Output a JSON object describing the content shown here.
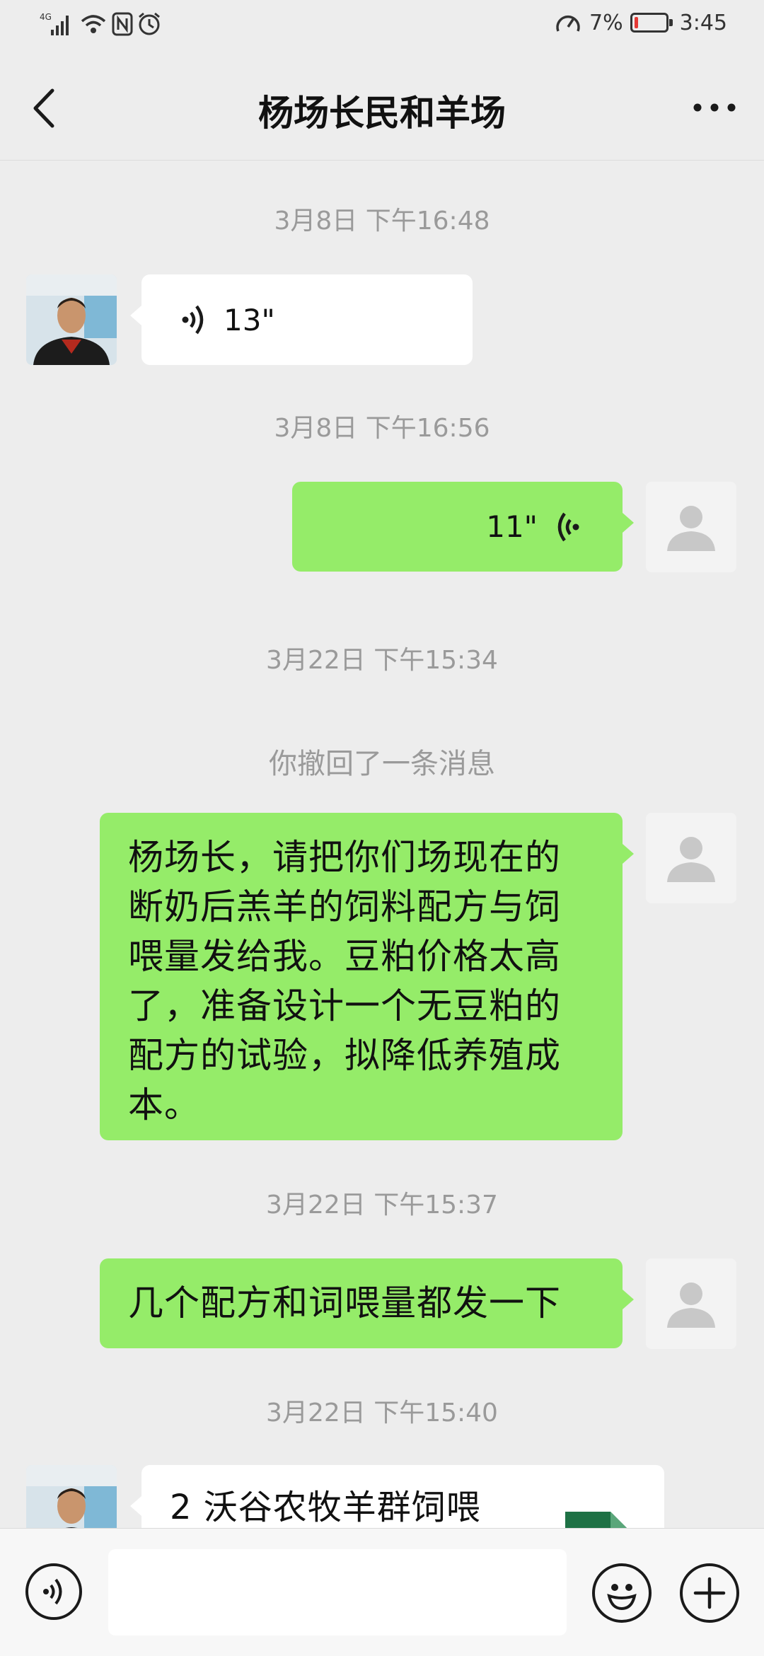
{
  "status_bar": {
    "network": "4G",
    "battery": "7%",
    "time": "3:45"
  },
  "header": {
    "title": "杨场长民和羊场",
    "back_icon": "chevron-left-icon",
    "more_icon": "more-dots-icon"
  },
  "messages": [
    {
      "type": "timestamp",
      "text": "3月8日 下午16:48"
    },
    {
      "type": "voice",
      "direction": "incoming",
      "duration": "13\""
    },
    {
      "type": "timestamp",
      "text": "3月8日 下午16:56"
    },
    {
      "type": "voice",
      "direction": "outgoing",
      "duration": "11\""
    },
    {
      "type": "timestamp",
      "text": "3月22日 下午15:34"
    },
    {
      "type": "system",
      "text": "你撤回了一条消息"
    },
    {
      "type": "text",
      "direction": "outgoing",
      "lines": [
        "杨场长，请把你们场现在的",
        "断奶后羔羊的饲料配方与饲",
        "喂量发给我。豆粕价格太高",
        "了，准备设计一个无豆粕的",
        "配方的试验，拟降低养殖成",
        "本。"
      ]
    },
    {
      "type": "timestamp",
      "text": "3月22日 下午15:37"
    },
    {
      "type": "text",
      "direction": "outgoing",
      "lines": [
        "几个配方和词喂量都发一下"
      ]
    },
    {
      "type": "timestamp",
      "text": "3月22日 下午15:40"
    },
    {
      "type": "file",
      "direction": "incoming",
      "name": "2 沃谷农牧羊群饲喂"
    }
  ],
  "colors": {
    "background": "#ededed",
    "outgoing_bubble": "#95ec69",
    "incoming_bubble": "#ffffff",
    "timestamp": "#9a9a9a",
    "file_icon": "#1e7145"
  },
  "bottom_bar": {
    "voice_icon": "voice-input-icon",
    "emoji_icon": "emoji-icon",
    "plus_icon": "plus-icon",
    "input_value": ""
  }
}
